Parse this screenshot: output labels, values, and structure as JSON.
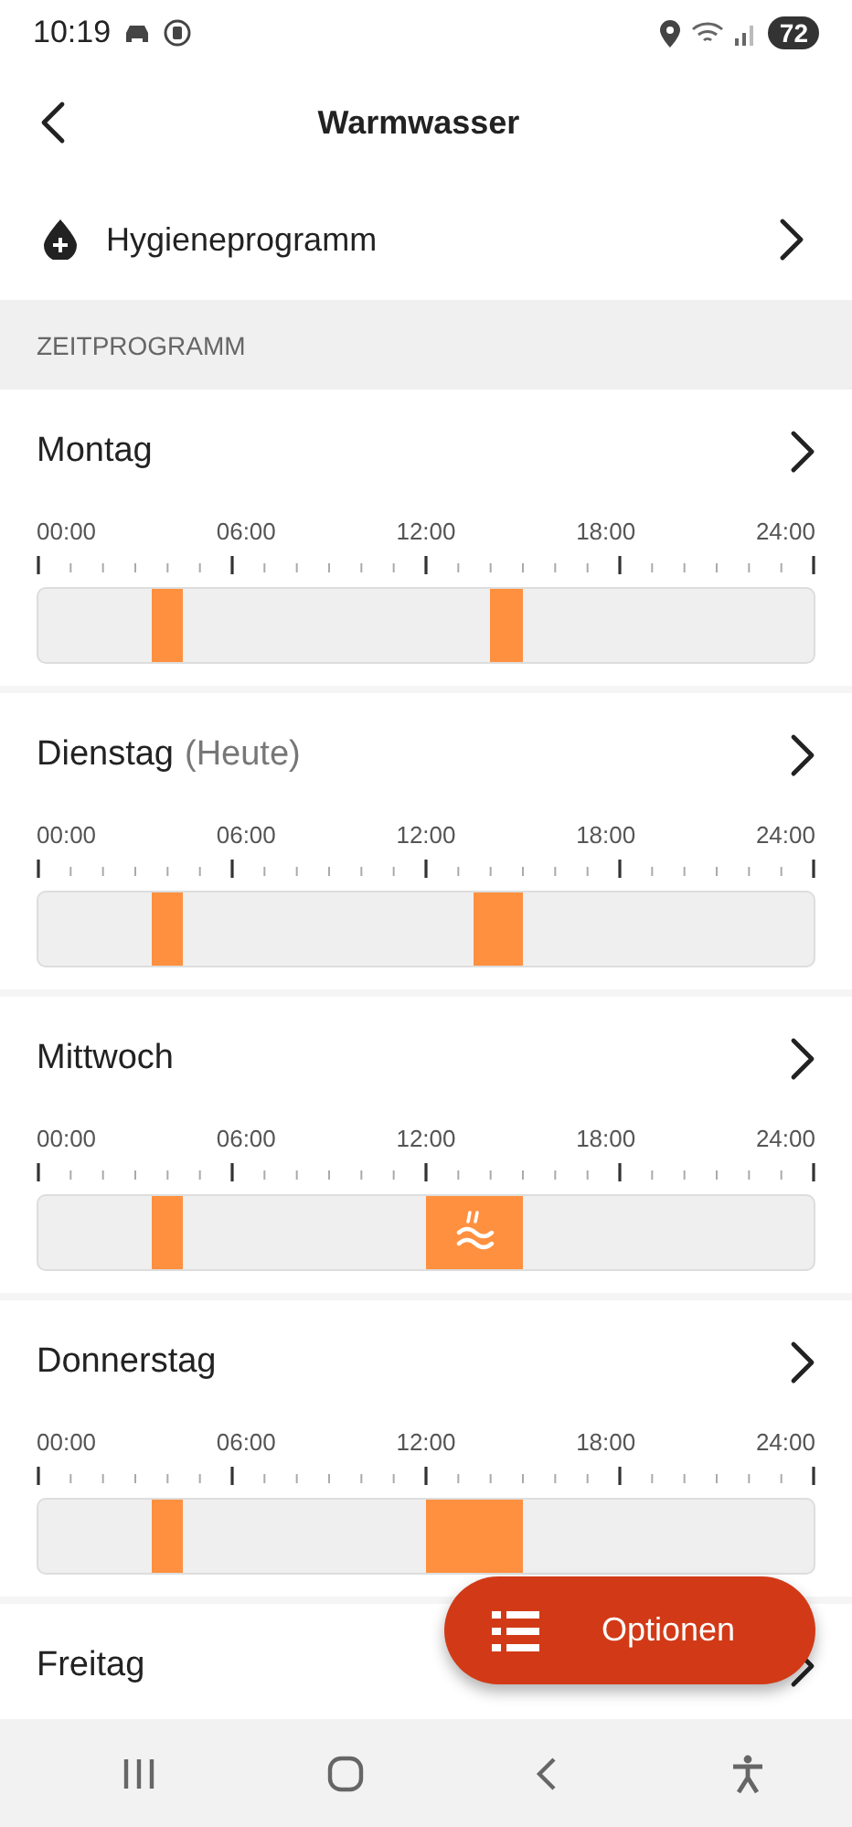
{
  "status_bar": {
    "time": "10:19",
    "battery": "72"
  },
  "header": {
    "title": "Warmwasser"
  },
  "hygiene": {
    "label": "Hygieneprogramm"
  },
  "section": {
    "title": "ZEITPROGRAMM"
  },
  "days": [
    {
      "name": "Montag",
      "hot_water_icon": false,
      "axis_labels": [
        "00:00",
        "06:00",
        "12:00",
        "18:00",
        "24:00"
      ],
      "half_hours": [
        {
          "on": false
        },
        {
          "on": false
        },
        {
          "on": false
        },
        {
          "on": false
        },
        {
          "on": false
        },
        {
          "on": false
        },
        {
          "on": false
        },
        {
          "on": true
        },
        {
          "on": true
        },
        {
          "on": false
        },
        {
          "on": false
        },
        {
          "on": false
        },
        {
          "on": false
        },
        {
          "on": false
        },
        {
          "on": false
        },
        {
          "on": false
        },
        {
          "on": false
        },
        {
          "on": false
        },
        {
          "on": false
        },
        {
          "on": false
        },
        {
          "on": false
        },
        {
          "on": false
        },
        {
          "on": false
        },
        {
          "on": false
        },
        {
          "on": false
        },
        {
          "on": false
        },
        {
          "on": false
        },
        {
          "on": false
        },
        {
          "on": true
        },
        {
          "on": true
        },
        {
          "on": false
        },
        {
          "on": false
        },
        {
          "on": false
        },
        {
          "on": false
        },
        {
          "on": false
        },
        {
          "on": false
        },
        {
          "on": false
        },
        {
          "on": false
        },
        {
          "on": false
        },
        {
          "on": false
        },
        {
          "on": false
        },
        {
          "on": false
        },
        {
          "on": false
        },
        {
          "on": false
        },
        {
          "on": false
        },
        {
          "on": false
        },
        {
          "on": false
        },
        {
          "on": false
        }
      ]
    },
    {
      "name": "Dienstag",
      "note": "(Heute)",
      "hot_water_icon": false,
      "axis_labels": [
        "00:00",
        "06:00",
        "12:00",
        "18:00",
        "24:00"
      ],
      "half_hours": [
        {
          "on": false
        },
        {
          "on": false
        },
        {
          "on": false
        },
        {
          "on": false
        },
        {
          "on": false
        },
        {
          "on": false
        },
        {
          "on": false
        },
        {
          "on": true
        },
        {
          "on": true
        },
        {
          "on": false
        },
        {
          "on": false
        },
        {
          "on": false
        },
        {
          "on": false
        },
        {
          "on": false
        },
        {
          "on": false
        },
        {
          "on": false
        },
        {
          "on": false
        },
        {
          "on": false
        },
        {
          "on": false
        },
        {
          "on": false
        },
        {
          "on": false
        },
        {
          "on": false
        },
        {
          "on": false
        },
        {
          "on": false
        },
        {
          "on": false
        },
        {
          "on": false
        },
        {
          "on": false
        },
        {
          "on": true
        },
        {
          "on": true
        },
        {
          "on": true
        },
        {
          "on": false
        },
        {
          "on": false
        },
        {
          "on": false
        },
        {
          "on": false
        },
        {
          "on": false
        },
        {
          "on": false
        },
        {
          "on": false
        },
        {
          "on": false
        },
        {
          "on": false
        },
        {
          "on": false
        },
        {
          "on": false
        },
        {
          "on": false
        },
        {
          "on": false
        },
        {
          "on": false
        },
        {
          "on": false
        },
        {
          "on": false
        },
        {
          "on": false
        },
        {
          "on": false
        }
      ]
    },
    {
      "name": "Mittwoch",
      "hot_water_icon": true,
      "axis_labels": [
        "00:00",
        "06:00",
        "12:00",
        "18:00",
        "24:00"
      ],
      "half_hours": [
        {
          "on": false
        },
        {
          "on": false
        },
        {
          "on": false
        },
        {
          "on": false
        },
        {
          "on": false
        },
        {
          "on": false
        },
        {
          "on": false
        },
        {
          "on": true
        },
        {
          "on": true
        },
        {
          "on": false
        },
        {
          "on": false
        },
        {
          "on": false
        },
        {
          "on": false
        },
        {
          "on": false
        },
        {
          "on": false
        },
        {
          "on": false
        },
        {
          "on": false
        },
        {
          "on": false
        },
        {
          "on": false
        },
        {
          "on": false
        },
        {
          "on": false
        },
        {
          "on": false
        },
        {
          "on": false
        },
        {
          "on": false
        },
        {
          "on": true
        },
        {
          "on": true
        },
        {
          "on": true
        },
        {
          "on": true
        },
        {
          "on": true
        },
        {
          "on": true
        },
        {
          "on": false
        },
        {
          "on": false
        },
        {
          "on": false
        },
        {
          "on": false
        },
        {
          "on": false
        },
        {
          "on": false
        },
        {
          "on": false
        },
        {
          "on": false
        },
        {
          "on": false
        },
        {
          "on": false
        },
        {
          "on": false
        },
        {
          "on": false
        },
        {
          "on": false
        },
        {
          "on": false
        },
        {
          "on": false
        },
        {
          "on": false
        },
        {
          "on": false
        },
        {
          "on": false
        }
      ]
    },
    {
      "name": "Donnerstag",
      "hot_water_icon": false,
      "axis_labels": [
        "00:00",
        "06:00",
        "12:00",
        "18:00",
        "24:00"
      ],
      "half_hours": [
        {
          "on": false
        },
        {
          "on": false
        },
        {
          "on": false
        },
        {
          "on": false
        },
        {
          "on": false
        },
        {
          "on": false
        },
        {
          "on": false
        },
        {
          "on": true
        },
        {
          "on": true
        },
        {
          "on": false
        },
        {
          "on": false
        },
        {
          "on": false
        },
        {
          "on": false
        },
        {
          "on": false
        },
        {
          "on": false
        },
        {
          "on": false
        },
        {
          "on": false
        },
        {
          "on": false
        },
        {
          "on": false
        },
        {
          "on": false
        },
        {
          "on": false
        },
        {
          "on": false
        },
        {
          "on": false
        },
        {
          "on": false
        },
        {
          "on": true
        },
        {
          "on": true
        },
        {
          "on": true
        },
        {
          "on": true
        },
        {
          "on": true
        },
        {
          "on": true
        },
        {
          "on": false
        },
        {
          "on": false
        },
        {
          "on": false
        },
        {
          "on": false
        },
        {
          "on": false
        },
        {
          "on": false
        },
        {
          "on": false
        },
        {
          "on": false
        },
        {
          "on": false
        },
        {
          "on": false
        },
        {
          "on": false
        },
        {
          "on": false
        },
        {
          "on": false
        },
        {
          "on": false
        },
        {
          "on": false
        },
        {
          "on": false
        },
        {
          "on": false
        },
        {
          "on": false
        }
      ]
    },
    {
      "name": "Freitag"
    }
  ],
  "fab": {
    "label": "Optionen"
  }
}
